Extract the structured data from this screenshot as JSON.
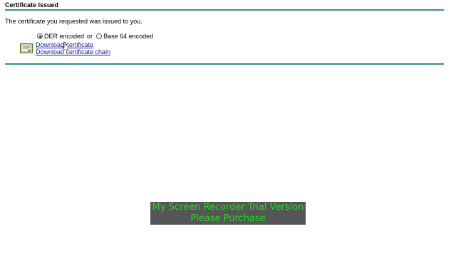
{
  "page": {
    "title": "Certificate Issued",
    "message": "The certificate you requested was issued to you."
  },
  "encoding": {
    "der_label": "DER encoded",
    "separator": "or",
    "base64_label": "Base 64 encoded",
    "selected": "DER"
  },
  "links": {
    "download_certificate": "Download certificate",
    "download_chain": "Download certificate chain"
  },
  "watermark": {
    "line1": "My Screen Recorder Trial Version",
    "line2": "Please Purchase"
  },
  "colors": {
    "rule": "#3a8a9a",
    "link": "#1a1aa6",
    "watermark_text": "#22dd22",
    "watermark_bg": "#555555"
  },
  "icons": {
    "certificate": "certificate-icon",
    "cursor": "mouse-cursor-icon"
  }
}
